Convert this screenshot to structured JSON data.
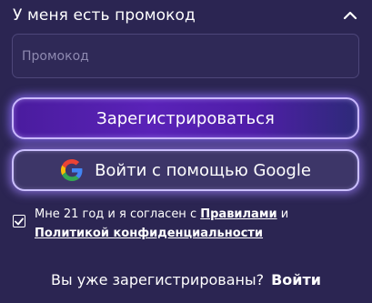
{
  "promo": {
    "header_label": "У меня есть промокод",
    "toggle_icon": "chevron-up-icon",
    "input_value": "",
    "input_placeholder": "Промокод"
  },
  "buttons": {
    "register_label": "Зарегистрироваться",
    "google_label": "Войти с помощью Google",
    "google_icon": "google-icon"
  },
  "consent": {
    "checked": true,
    "text_before": "Мне 21 год и я согласен с ",
    "rules_link": "Правилами",
    "text_and": " и ",
    "policy_link": "Политикой конфиденциальности"
  },
  "footer": {
    "question": "Вы уже зарегистрированы?",
    "login_label": "Войти"
  },
  "colors": {
    "background": "#2b2552",
    "register_button": "#4a1c9e",
    "google_button": "#3d3668",
    "glow_border": "#c9b8ff"
  }
}
